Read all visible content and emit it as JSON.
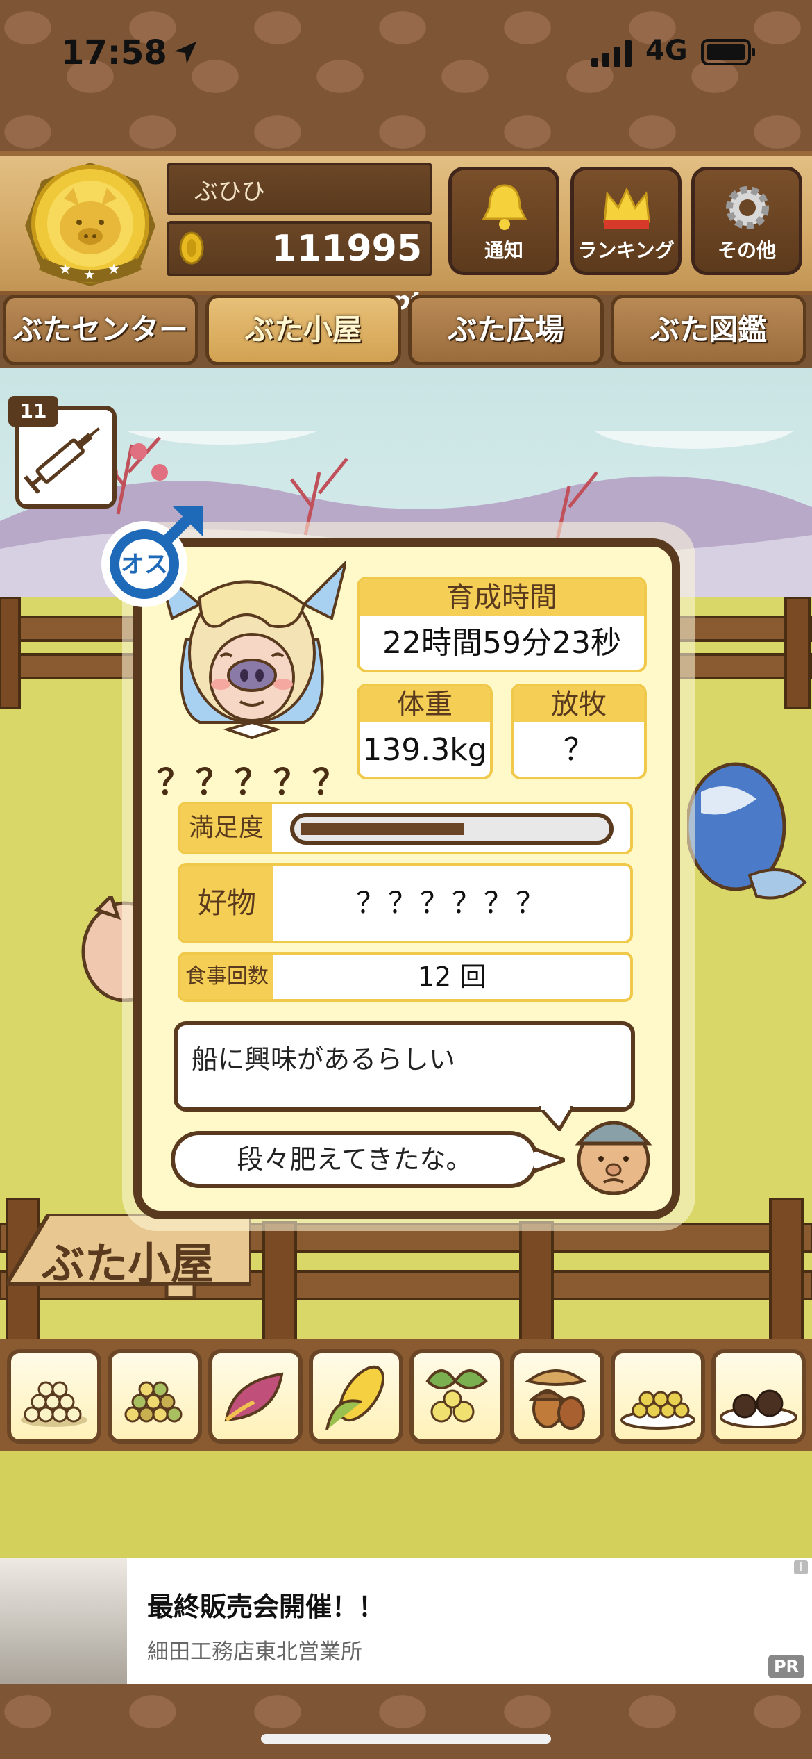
{
  "status_bar": {
    "time": "17:58",
    "network": "4G"
  },
  "header": {
    "player_name": "ぶひひ",
    "points": "111995",
    "points_unit": "pt",
    "buttons": [
      {
        "label": "通知",
        "icon": "bell-icon"
      },
      {
        "label": "ランキング",
        "icon": "crown-icon"
      },
      {
        "label": "その他",
        "icon": "gear-icon"
      }
    ]
  },
  "nav_tabs": [
    {
      "label": "ぶたセンター",
      "active": false
    },
    {
      "label": "ぶた小屋",
      "active": true
    },
    {
      "label": "ぶた広場",
      "active": false
    },
    {
      "label": "ぶた図鑑",
      "active": false
    }
  ],
  "syringe": {
    "count": "11"
  },
  "pig": {
    "gender_label": "オス",
    "name": "？？？？？",
    "raising_time_label": "育成時間",
    "raising_time": "22時間59分23秒",
    "weight_label": "体重",
    "weight": "139.3kg",
    "grazing_label": "放牧",
    "grazing": "？",
    "satisfaction_label": "満足度",
    "satisfaction_level": 0.54,
    "favorite_label": "好物",
    "favorite": "？？？？？？",
    "meals_label": "食事回数",
    "meals": "12 回",
    "comment": "船に興味があるらしい",
    "farmer_comment": "段々肥えてきたな。"
  },
  "hut_sign": "ぶた小屋",
  "food_items": [
    {
      "name": "grain-pile-white-icon"
    },
    {
      "name": "grain-pile-mixed-icon"
    },
    {
      "name": "sweet-potato-icon"
    },
    {
      "name": "corn-icon"
    },
    {
      "name": "beans-icon"
    },
    {
      "name": "acorn-icon"
    },
    {
      "name": "soybeans-icon"
    },
    {
      "name": "truffle-icon"
    }
  ],
  "ad": {
    "title": "最終販売会開催！！",
    "subtitle": "細田工務店東北営業所",
    "info": "i",
    "pr": "PR"
  },
  "colors": {
    "wood_dark": "#5a3a1e",
    "card_bg": "#fff8c8",
    "label_yellow": "#f5cf55",
    "field": "#d8d768"
  }
}
